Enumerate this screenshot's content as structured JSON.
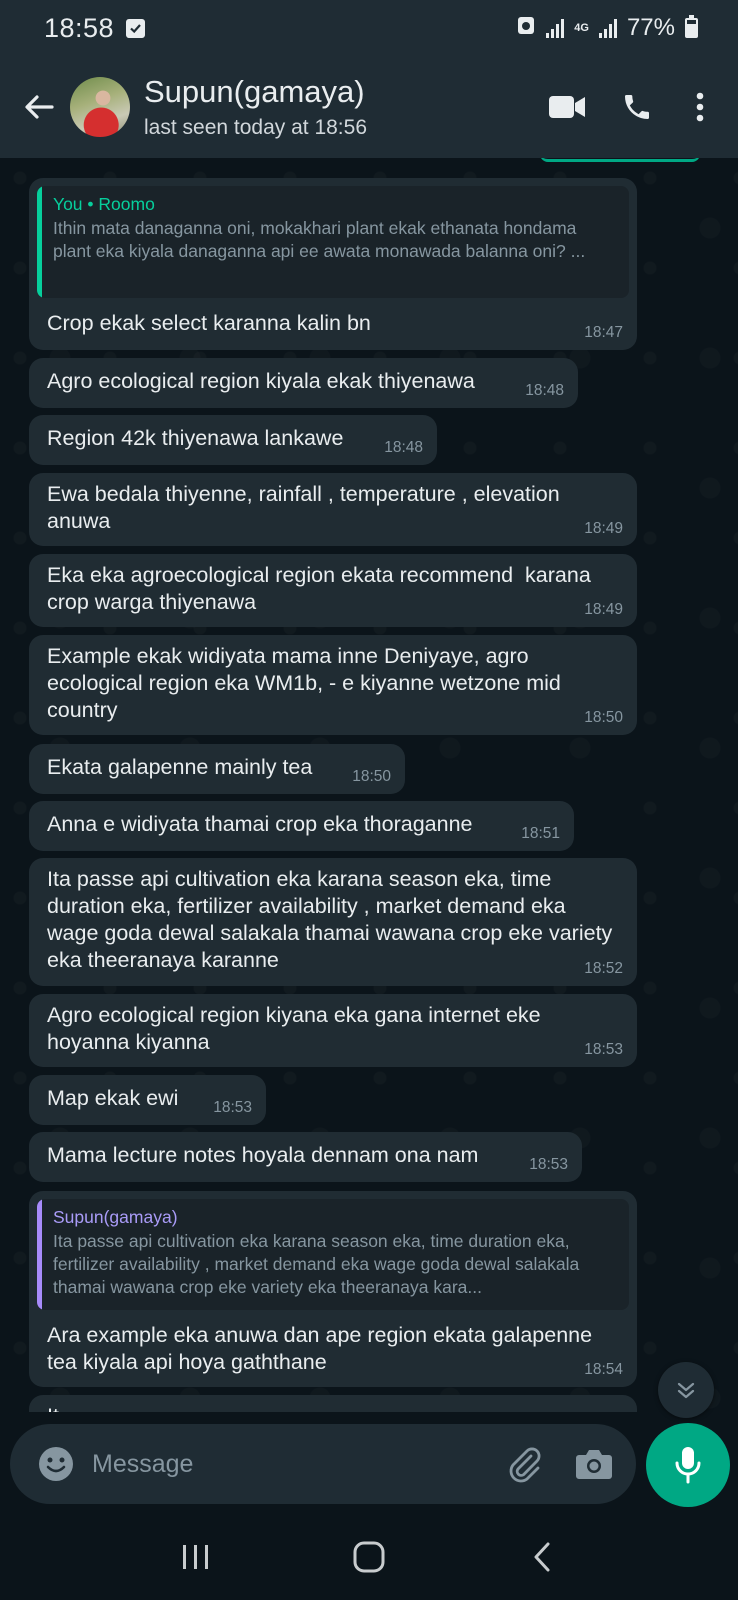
{
  "status_bar": {
    "time": "18:58",
    "battery": "77%",
    "network": "4G"
  },
  "header": {
    "contact_name": "Supun(gamaya)",
    "contact_status": "last seen today at 18:56"
  },
  "messages": [
    {
      "quote": {
        "author": "You • Roomo",
        "text": "Ithin mata danaganna oni, mokakhari plant ekak ethanata hondama plant eka kiyala danaganna api ee awata monawada balanna oni? ..."
      },
      "text": "Crop ekak select karanna kalin bn",
      "time": "18:47"
    },
    {
      "text": "Agro ecological region kiyala ekak thiyenawa",
      "time": "18:48"
    },
    {
      "text": "Region 42k thiyenawa lankawe",
      "time": "18:48"
    },
    {
      "text": "Ewa bedala thiyenne, rainfall , temperature , elevation anuwa",
      "time": "18:49"
    },
    {
      "text": "Eka eka agroecological region ekata recommend  karana crop warga thiyenawa",
      "time": "18:49"
    },
    {
      "text": "Example ekak widiyata mama inne Deniyaye, agro ecological region eka WM1b, - e kiyanne wetzone mid country",
      "time": "18:50"
    },
    {
      "text": "Ekata galapenne mainly tea",
      "time": "18:50"
    },
    {
      "text": "Anna e widiyata thamai crop eka thoraganne",
      "time": "18:51"
    },
    {
      "text": "Ita passe api cultivation eka karana season eka, time duration eka, fertilizer availability , market demand eka wage goda dewal salakala thamai wawana crop eke variety eka theeranaya karanne",
      "time": "18:52"
    },
    {
      "text": "Agro ecological region kiyana eka gana internet eke hoyanna kiyanna",
      "time": "18:53"
    },
    {
      "text": "Map ekak ewi",
      "time": "18:53"
    },
    {
      "text": "Mama lecture notes hoyala dennam ona nam",
      "time": "18:53"
    },
    {
      "quote": {
        "author": "Supun(gamaya)",
        "text": "Ita passe api cultivation eka karana season eka, time duration eka, fertilizer availability , market demand eka wage goda dewal salakala thamai wawana crop eke variety eka theeranaya kara..."
      },
      "text": "Ara example eka anuwa dan ape region ekata galapenne tea kiyala api hoya gaththane",
      "time": "18:54"
    },
    {
      "text": "It...",
      "time": ""
    }
  ],
  "composer": {
    "placeholder": "Message"
  },
  "colors": {
    "accent": "#00a884",
    "bubble": "#202c33",
    "header": "#1f2c34",
    "background": "#0b141a"
  },
  "icons": [
    "back-arrow-icon",
    "video-call-icon",
    "phone-icon",
    "more-options-icon",
    "emoji-icon",
    "attach-icon",
    "camera-icon",
    "mic-icon",
    "scroll-down-icon",
    "recents-icon",
    "home-icon",
    "nav-back-icon"
  ]
}
